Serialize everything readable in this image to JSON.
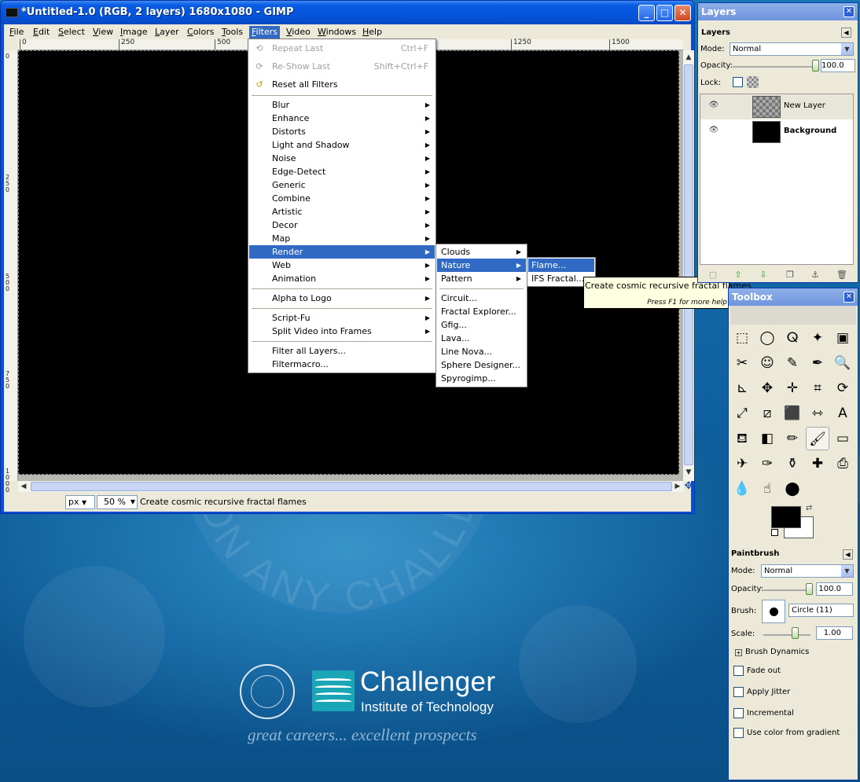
{
  "window": {
    "title": "*Untitled-1.0 (RGB, 2 layers) 1680x1080 - GIMP",
    "minimize": "_",
    "maximize": "□",
    "close": "✕"
  },
  "menubar": [
    {
      "label": "File",
      "key": "F",
      "rest": "ile"
    },
    {
      "label": "Edit",
      "key": "E",
      "rest": "dit"
    },
    {
      "label": "Select",
      "key": "S",
      "rest": "elect"
    },
    {
      "label": "View",
      "key": "V",
      "rest": "iew"
    },
    {
      "label": "Image",
      "key": "I",
      "rest": "mage"
    },
    {
      "label": "Layer",
      "key": "L",
      "rest": "ayer"
    },
    {
      "label": "Colors",
      "key": "C",
      "rest": "olors"
    },
    {
      "label": "Tools",
      "key": "T",
      "rest": "ools"
    },
    {
      "label": "Filters",
      "key": "F",
      "rest": "ilters"
    },
    {
      "label": "Video",
      "key": "V",
      "rest": "ideo"
    },
    {
      "label": "Windows",
      "key": "W",
      "rest": "indows"
    },
    {
      "label": "Help",
      "key": "H",
      "rest": "elp"
    }
  ],
  "rulers": {
    "top": [
      "0",
      "250",
      "500",
      "1250",
      "1500"
    ],
    "left": [
      "0",
      "250",
      "500",
      "750",
      "1000"
    ]
  },
  "statusbar": {
    "unit": "px",
    "zoom": "50 %",
    "message": "Create cosmic recursive fractal flames"
  },
  "filters_menu": {
    "top": [
      {
        "label": "Repeat Last",
        "accel": "Ctrl+F"
      },
      {
        "label": "Re-Show Last",
        "accel": "Shift+Ctrl+F"
      },
      {
        "label": "Reset all Filters"
      }
    ],
    "groups": [
      "Blur",
      "Enhance",
      "Distorts",
      "Light and Shadow",
      "Noise",
      "Edge-Detect",
      "Generic",
      "Combine",
      "Artistic",
      "Decor",
      "Map",
      "Render",
      "Web",
      "Animation"
    ],
    "alpha": "Alpha to Logo",
    "script": [
      "Script-Fu",
      "Split Video into Frames"
    ],
    "bottom": [
      "Filter all Layers...",
      "Filtermacro..."
    ]
  },
  "render_menu": {
    "subs": [
      "Clouds",
      "Nature",
      "Pattern"
    ],
    "items": [
      "Circuit...",
      "Fractal Explorer...",
      "Gfig...",
      "Lava...",
      "Line Nova...",
      "Sphere Designer...",
      "Spyrogimp..."
    ]
  },
  "nature_menu": {
    "items": [
      "Flame...",
      "IFS Fractal..."
    ]
  },
  "tooltip": {
    "text": "Create cosmic recursive fractal flames",
    "help": "Press F1 for more help"
  },
  "layers_dock": {
    "title": "Layers",
    "tab": "Layers",
    "mode_label": "Mode:",
    "mode": "Normal",
    "opacity_label": "Opacity:",
    "opacity": "100.0",
    "lock_label": "Lock:",
    "layers": [
      {
        "name": "New Layer"
      },
      {
        "name": "Background"
      }
    ]
  },
  "toolbox": {
    "title": "Toolbox",
    "tools": [
      "rect-select",
      "ellipse-select",
      "free-select",
      "fuzzy-select",
      "color-select",
      "scissors",
      "foreground-select",
      "paths",
      "color-picker",
      "zoom",
      "measure",
      "move",
      "align",
      "crop",
      "rotate",
      "scale",
      "shear",
      "perspective",
      "flip",
      "text",
      "bucket-fill",
      "blend",
      "pencil",
      "paintbrush",
      "eraser",
      "airbrush",
      "ink",
      "clone",
      "heal",
      "perspective-clone",
      "blur-sharpen",
      "smudge",
      "dodge-burn"
    ],
    "glyphs": [
      "⬚",
      "◯",
      "ⵕ",
      "✦",
      "▣",
      "✂",
      "☺",
      "✎",
      "✒",
      "🔍",
      "⊾",
      "✥",
      "✛",
      "⌗",
      "⟳",
      "⤢",
      "⧄",
      "⬛",
      "⇿",
      "A",
      "⛾",
      "◧",
      "✏",
      "🖌",
      "▭",
      "✈",
      "✑",
      "⚱",
      "✚",
      "⎙",
      "💧",
      "☝",
      "⬤"
    ],
    "fg": "#000000",
    "bg": "#ffffff"
  },
  "paintbrush": {
    "title": "Paintbrush",
    "mode_label": "Mode:",
    "mode": "Normal",
    "opacity_label": "Opacity:",
    "opacity": "100.0",
    "brush_label": "Brush:",
    "brush": "Circle (11)",
    "scale_label": "Scale:",
    "scale": "1.00",
    "dynamics": "Brush Dynamics",
    "options": [
      "Fade out",
      "Apply Jitter",
      "Incremental",
      "Use color from gradient"
    ]
  },
  "wallpaper": {
    "arc_text": "ON ANY CHALLENGER",
    "brand": "Challenger",
    "brand_sub": "Institute of Technology",
    "slogan": "great careers... excellent prospects"
  }
}
